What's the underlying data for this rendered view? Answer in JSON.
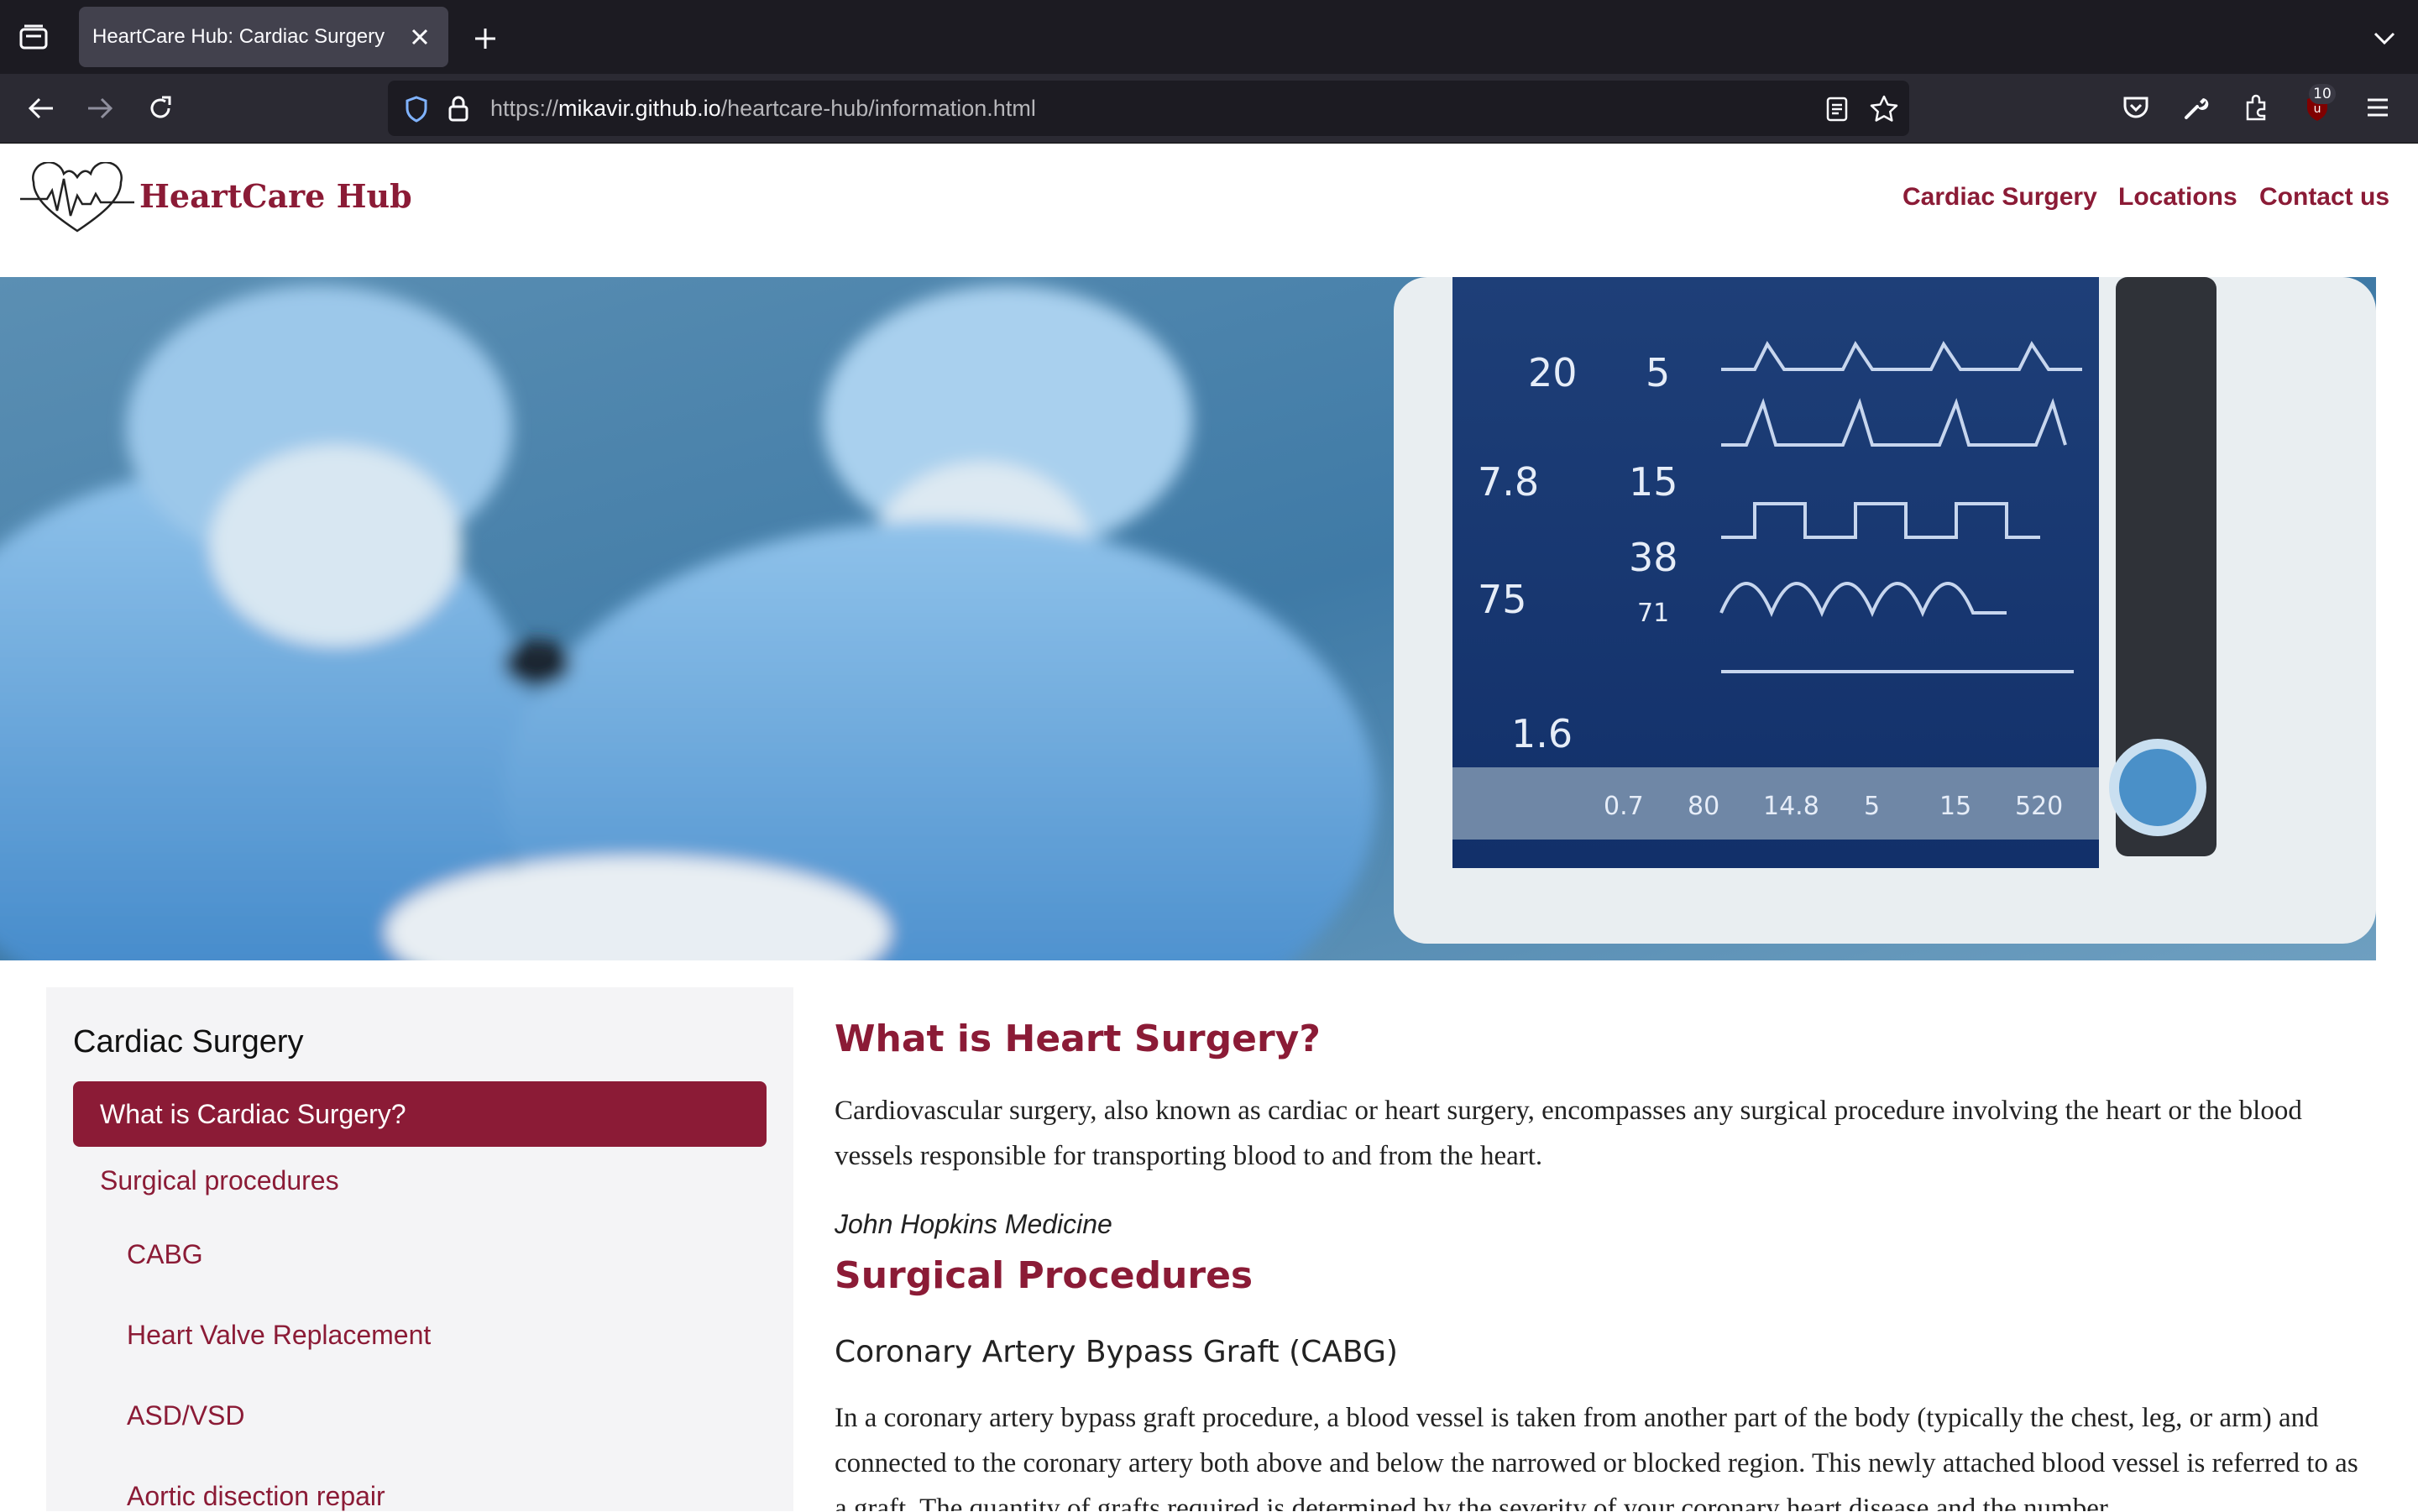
{
  "browser": {
    "tab_title": "HeartCare Hub: Cardiac Surgery",
    "url_scheme": "https://",
    "url_host": "mikavir.github.io",
    "url_path": "/heartcare-hub/information.html",
    "extension_badge": "10",
    "icons": [
      "tab-overview-icon",
      "close-icon",
      "new-tab-icon",
      "chevron-down-icon",
      "back-icon",
      "forward-icon",
      "reload-icon",
      "shield-icon",
      "lock-icon",
      "reader-view-icon",
      "bookmark-star-icon",
      "pocket-icon",
      "wrench-icon",
      "extensions-icon",
      "ublock-icon",
      "menu-icon"
    ]
  },
  "site": {
    "brand": "HeartCare Hub",
    "nav": [
      "Cardiac Surgery",
      "Locations",
      "Contact us"
    ],
    "accent_color": "#8b1b36"
  },
  "hero": {
    "monitor_numbers": [
      "20",
      "5",
      "7.8",
      "15",
      "75",
      "38",
      "71",
      "1.6",
      "0.7",
      "80",
      "14.8",
      "5",
      "15",
      "520"
    ]
  },
  "sidebar": {
    "title": "Cardiac Surgery",
    "active_item": "What is Cardiac Surgery?",
    "section_item": "Surgical procedures",
    "sub_items": [
      "CABG",
      "Heart Valve Replacement",
      "ASD/VSD",
      "Aortic disection repair"
    ]
  },
  "main": {
    "heading": "What is Heart Surgery?",
    "intro": "Cardiovascular surgery, also known as cardiac or heart surgery, encompasses any surgical procedure involving the heart or the blood vessels responsible for transporting blood to and from the heart.",
    "citation": "John Hopkins Medicine",
    "section_heading": "Surgical Procedures",
    "subheading": "Coronary Artery Bypass Graft (CABG)",
    "cabg_text": "In a coronary artery bypass graft procedure, a blood vessel is taken from another part of the body (typically the chest, leg, or arm) and connected to the coronary artery both above and below the narrowed or blocked region. This newly attached blood vessel is referred to as a graft. The quantity of grafts required is determined by the severity of your coronary heart disease and the number"
  }
}
